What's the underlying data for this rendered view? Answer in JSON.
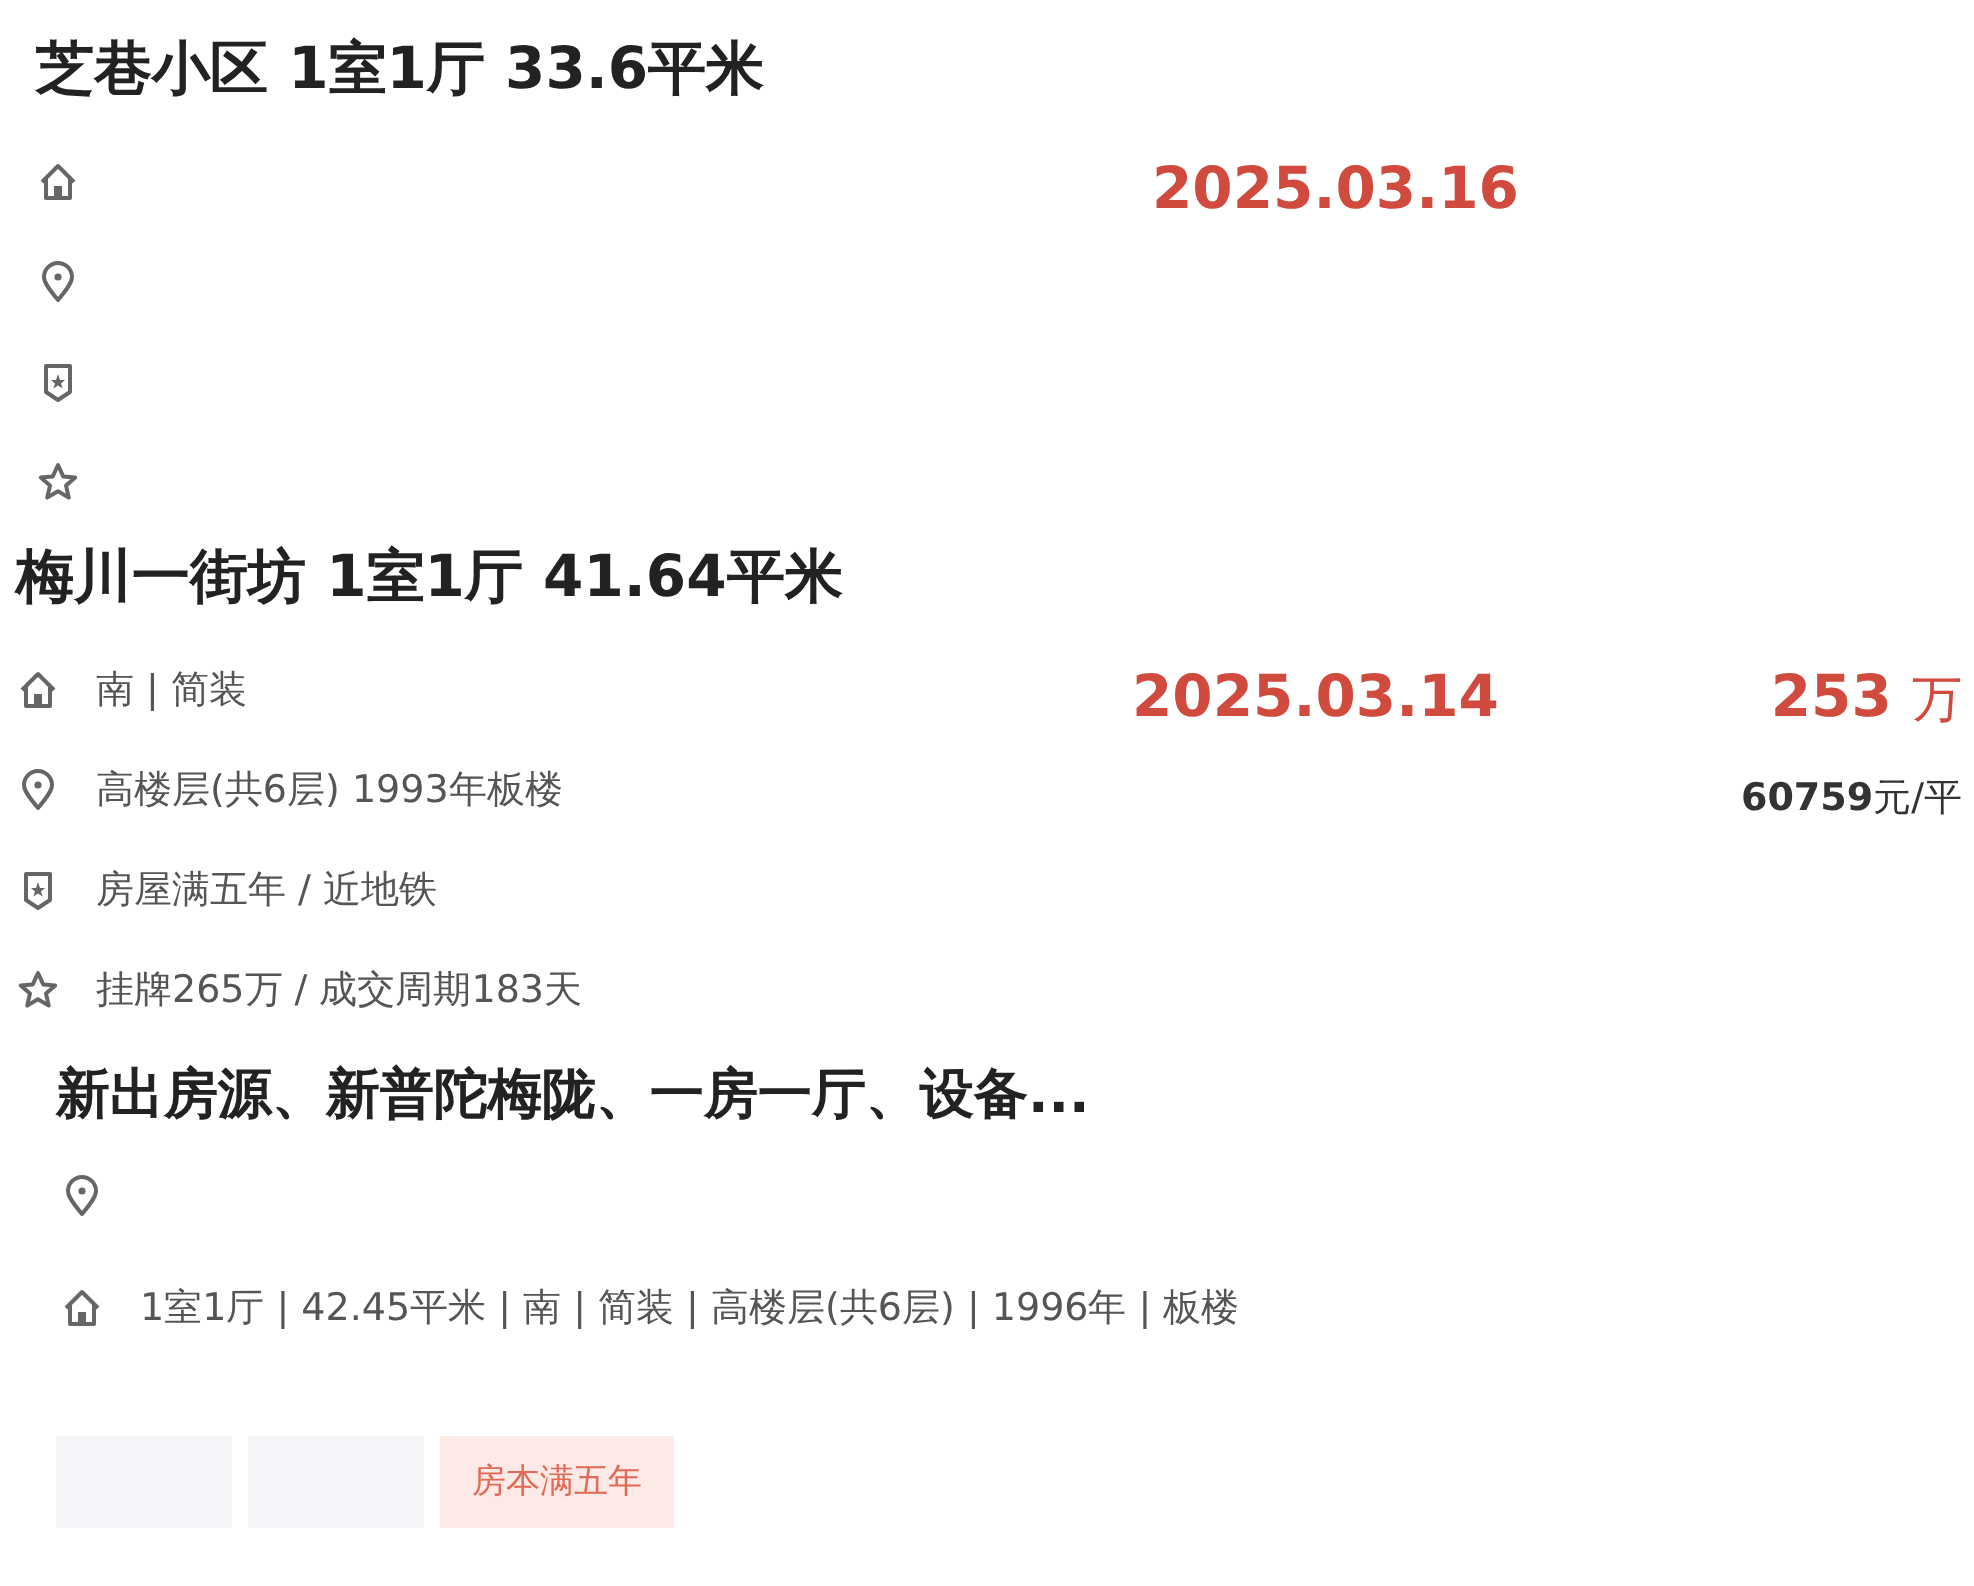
{
  "listings": [
    {
      "kind": "deal",
      "title": "芝巷小区 1室1厅 33.6平米",
      "details": [
        {
          "kind": "house"
        },
        {
          "kind": "pin"
        },
        {
          "kind": "shield"
        },
        {
          "kind": "star"
        }
      ],
      "date": "2025.03.16"
    },
    {
      "kind": "deal",
      "title": "梅川一街坊 1室1厅 41.64平米",
      "details": [
        {
          "kind": "house",
          "text": "南 | 简装"
        },
        {
          "kind": "pin",
          "text": "高楼层(共6层) 1993年板楼"
        },
        {
          "kind": "shield",
          "text": "房屋满五年 / 近地铁"
        },
        {
          "kind": "star",
          "text": "挂牌265万 / 成交周期183天"
        }
      ],
      "date": "2025.03.14",
      "price": "253",
      "price_unit": "万",
      "unit_price": "60759",
      "unit_price_suffix": "元/平"
    },
    {
      "kind": "listing",
      "title": "新出房源、新普陀梅陇、一房一厅、设备...",
      "details": [
        {
          "kind": "pin"
        },
        {
          "kind": "house",
          "text": "1室1厅 | 42.45平米 | 南 | 简装 | 高楼层(共6层) | 1996年 | 板楼"
        }
      ],
      "tags": [
        {
          "kind": "blank"
        },
        {
          "kind": "blank"
        },
        {
          "kind": "text",
          "text": "房本满五年"
        }
      ]
    }
  ]
}
